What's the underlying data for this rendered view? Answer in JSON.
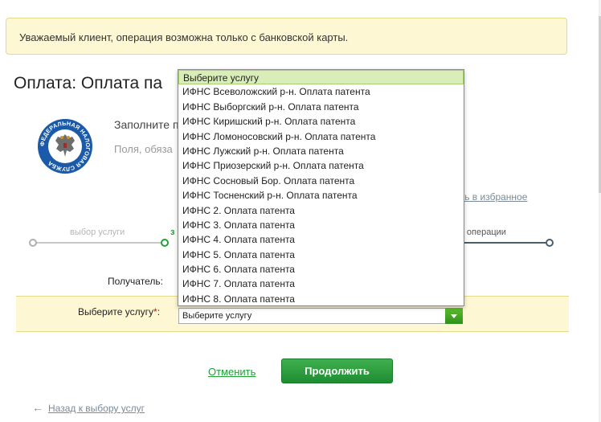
{
  "notice": {
    "text": "Уважаемый клиент, операция возможна только с банковской карты."
  },
  "page": {
    "title": "Оплата: Оплата па"
  },
  "form": {
    "hint_line1": "Заполните п",
    "hint_line2": "Поля, обяза",
    "favorites_link": "ить в избранное",
    "recipient_label": "Получатель:",
    "service_label": "Выберите услугу",
    "required_mark": "*",
    "label_colon": ":",
    "service_select_value": "Выберите услугу"
  },
  "steps": {
    "step1_label": "выбор услуги",
    "step2_label": "з",
    "step3_label": "ус операции",
    "colors": {
      "done": "#21a038",
      "inactive": "#c8c8c8",
      "future": "#4a5e6e"
    }
  },
  "dropdown": {
    "options": [
      "Выберите услугу",
      "ИФНС Всеволожский р-н. Оплата патента",
      "ИФНС Выборгский р-н. Оплата патента",
      "ИФНС Киришский р-н. Оплата патента",
      "ИФНС Ломоносовский р-н. Оплата патента",
      "ИФНС Лужский р-н. Оплата патента",
      "ИФНС Приозерский р-н. Оплата патента",
      "ИФНС Сосновый Бор. Оплата патента",
      "ИФНС Тосненский р-н. Оплата патента",
      "ИФНС 2. Оплата патента",
      "ИФНС 3. Оплата патента",
      "ИФНС 4. Оплата патента",
      "ИФНС 5. Оплата патента",
      "ИФНС 6. Оплата патента",
      "ИФНС 7. Оплата патента",
      "ИФНС 8. Оплата патента"
    ],
    "selected_index": 0
  },
  "actions": {
    "cancel": "Отменить",
    "continue": "Продолжить"
  },
  "back_link": {
    "arrow": "←",
    "text": "Назад к выбору услуг"
  },
  "logo": {
    "icon": "federal-tax-service-emblem",
    "ring_text": "ФЕДЕРАЛЬНАЯ НАЛОГОВАЯ СЛУЖБА"
  },
  "colors": {
    "accent": "#21a038",
    "notice_bg": "#fdf8d3",
    "notice_border": "#e6d98a",
    "link_gray": "#7a8a99"
  }
}
